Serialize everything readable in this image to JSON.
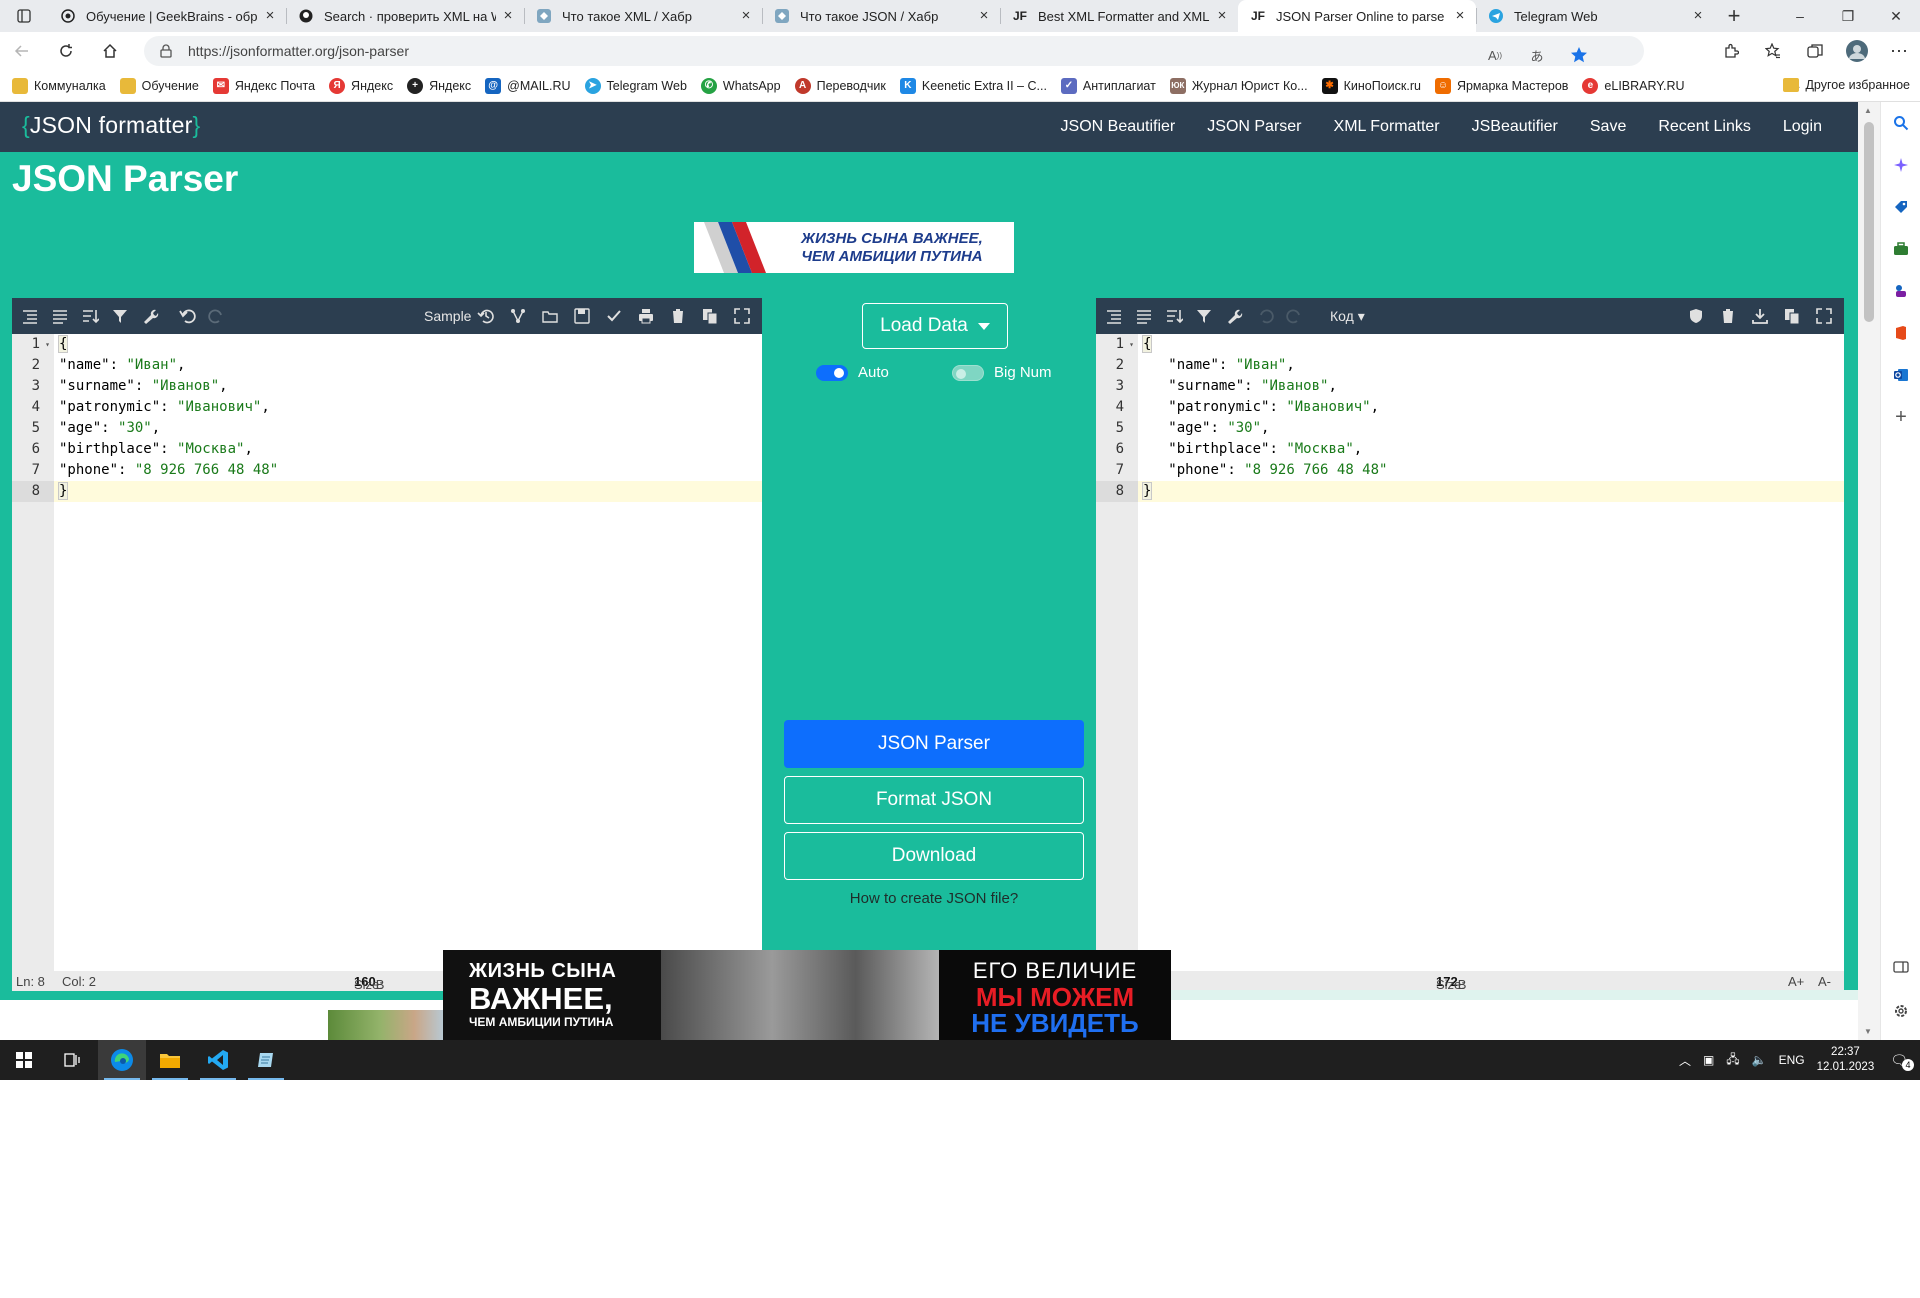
{
  "browser": {
    "tabs": [
      {
        "title": "Обучение | GeekBrains - образо",
        "icon": "geekbrains-icon"
      },
      {
        "title": "Search · проверить XML на Web",
        "icon": "github-icon"
      },
      {
        "title": "Что такое XML / Хабр",
        "icon": "habr-icon"
      },
      {
        "title": "Что такое JSON / Хабр",
        "icon": "habr-icon"
      },
      {
        "title": "Best XML Formatter and XML Be",
        "icon": "jf-icon"
      },
      {
        "title": "JSON Parser Online to parse JSO",
        "icon": "jf-icon",
        "active": true
      },
      {
        "title": "Telegram Web",
        "icon": "telegram-icon"
      }
    ],
    "tab_glyph_jf": "JF",
    "url": "https://jsonformatter.org/json-parser",
    "bookmarks": [
      {
        "label": "Коммуналка",
        "icon": "folder-icon",
        "color": "#e8b93a"
      },
      {
        "label": "Обучение",
        "icon": "folder-icon",
        "color": "#e8b93a"
      },
      {
        "label": "Яндекс Почта",
        "icon": "mail-icon",
        "color": "#e53935"
      },
      {
        "label": "Яндекс",
        "icon": "yandex-icon",
        "color": "#e53935"
      },
      {
        "label": "Яндекс",
        "icon": "yandex-plus-icon",
        "color": "#222222"
      },
      {
        "label": "@MAIL.RU",
        "icon": "mailru-icon",
        "color": "#1565c0"
      },
      {
        "label": "Telegram Web",
        "icon": "telegram-icon",
        "color": "#2aa3e0"
      },
      {
        "label": "WhatsApp",
        "icon": "whatsapp-icon",
        "color": "#25a244"
      },
      {
        "label": "Переводчик",
        "icon": "translator-icon",
        "color": "#c0392b"
      },
      {
        "label": "Keenetic Extra II – C...",
        "icon": "keenetic-icon",
        "color": "#1e88e5"
      },
      {
        "label": "Антиплагиат",
        "icon": "shield-icon",
        "color": "#5c6bc0"
      },
      {
        "label": "Журнал Юрист Ко...",
        "icon": "yuk-icon",
        "color": "#8d6e63"
      },
      {
        "label": "КиноПоиск.ru",
        "icon": "kinopoisk-icon",
        "color": "#ff6d00"
      },
      {
        "label": "Ярмарка Мастеров",
        "icon": "livemaster-icon",
        "color": "#ef6c00"
      },
      {
        "label": "eLIBRARY.RU",
        "icon": "elibrary-icon",
        "color": "#e53935"
      }
    ],
    "other_bookmarks": "Другое избранное"
  },
  "site": {
    "logo_open": "{",
    "logo_text": "JSON formatter",
    "logo_close": "}",
    "menu": [
      "JSON Beautifier",
      "JSON Parser",
      "XML Formatter",
      "JSBeautifier",
      "Save",
      "Recent Links",
      "Login"
    ],
    "page_title": "JSON Parser",
    "ad_top_line1": "ЖИЗНЬ СЫНА ВАЖНЕЕ,",
    "ad_top_line2": "ЧЕМ АМБИЦИИ ПУТИНА"
  },
  "left_editor": {
    "sample_label": "Sample",
    "line_numbers": [
      "1",
      "2",
      "3",
      "4",
      "5",
      "6",
      "7",
      "8"
    ],
    "lines": [
      {
        "k": "{",
        "v": ""
      },
      {
        "k": "\"name\"",
        "v": "\"Иван\""
      },
      {
        "k": "\"surname\"",
        "v": "\"Иванов\""
      },
      {
        "k": "\"patronymic\"",
        "v": "\"Иванович\""
      },
      {
        "k": "\"age\"",
        "v": "\"30\""
      },
      {
        "k": "\"birthplace\"",
        "v": "\"Москва\""
      },
      {
        "k": "\"phone\"",
        "v": "\"8 926 766 48 48\""
      },
      {
        "k": "}",
        "v": ""
      }
    ],
    "status_ln": "Ln: 8",
    "status_col": "Col: 2",
    "size_label": "Size:",
    "size_value": "160",
    "size_unit": "B"
  },
  "right_editor": {
    "mode_label": "Код",
    "size_label": "Size:",
    "size_value": "172",
    "size_unit": "B",
    "font_up": "A+",
    "font_down": "A-"
  },
  "middle": {
    "load_data": "Load Data",
    "toggle_auto": {
      "label": "Auto",
      "on": true
    },
    "toggle_bignum": {
      "label": "Big Num",
      "on": false
    },
    "btn_parser": "JSON Parser",
    "btn_format": "Format JSON",
    "btn_download": "Download",
    "howto_link": "How to create JSON file?"
  },
  "ad_bottom": {
    "left_a": "ЖИЗНЬ СЫНА",
    "left_b": "ВАЖНЕЕ,",
    "left_c": "ЧЕМ АМБИЦИИ ПУТИНА",
    "right_a": "ЕГО ВЕЛИЧИЕ",
    "right_b": "МЫ МОЖЕМ",
    "right_c": "НЕ УВИДЕТЬ"
  },
  "taskbar": {
    "lang": "ENG",
    "time": "22:37",
    "date": "12.01.2023",
    "notifications": "4"
  },
  "colors": {
    "teal": "#1abc9c",
    "navy": "#2c3e50",
    "primary": "#0d6efd",
    "string_green": "#1a7a1a"
  }
}
